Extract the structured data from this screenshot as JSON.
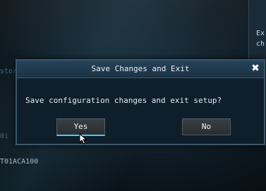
{
  "background": {
    "right_text_1": "Ex",
    "right_text_2": "ch",
    "left_label": "stor device",
    "left_mark": "0i",
    "left_code": "T01ACA100"
  },
  "dialog": {
    "title": "Save Changes and Exit",
    "message": "Save configuration changes and exit setup?",
    "yes_label": "Yes",
    "no_label": "No",
    "close_icon": "✖"
  },
  "colors": {
    "accent": "#55c6f0",
    "dialog_bg": "#0e1f2b",
    "titlebar": "#26435a"
  },
  "icons": [
    "close-icon",
    "mouse-pointer-icon"
  ]
}
